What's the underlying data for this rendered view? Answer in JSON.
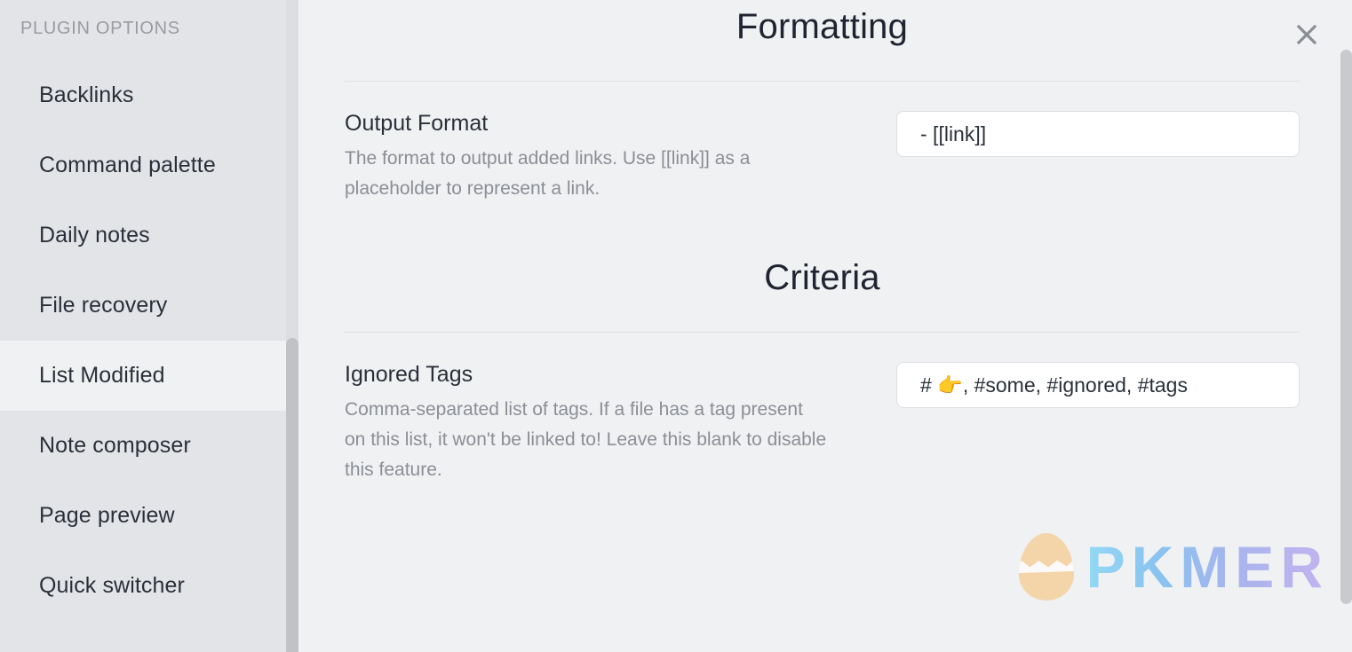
{
  "sidebar": {
    "title": "PLUGIN OPTIONS",
    "items": [
      {
        "label": "Backlinks",
        "active": false
      },
      {
        "label": "Command palette",
        "active": false
      },
      {
        "label": "Daily notes",
        "active": false
      },
      {
        "label": "File recovery",
        "active": false
      },
      {
        "label": "List Modified",
        "active": true
      },
      {
        "label": "Note composer",
        "active": false
      },
      {
        "label": "Page preview",
        "active": false
      },
      {
        "label": "Quick switcher",
        "active": false
      }
    ]
  },
  "main": {
    "close_label": "×",
    "sections": [
      {
        "heading": "Formatting",
        "settings": [
          {
            "name": "Output Format",
            "description": "The format to output added links. Use [[link]] as a placeholder to represent a link.",
            "value": "- [[link]]",
            "placeholder": ""
          }
        ]
      },
      {
        "heading": "Criteria",
        "settings": [
          {
            "name": "Ignored Tags",
            "description": "Comma-separated list of tags. If a file has a tag present on this list, it won't be linked to! Leave this blank to disable this feature.",
            "value": "# 👉, #some, #ignored, #tags",
            "placeholder": ""
          }
        ]
      }
    ]
  },
  "watermark": {
    "text": "PKMER"
  },
  "colors": {
    "sidebar_bg": "#e3e4e8",
    "main_bg": "#f0f1f3",
    "active_item_bg": "#f0f1f3",
    "text_primary": "#2a3039",
    "text_muted": "#8b8e95",
    "input_bg": "#ffffff",
    "input_border": "#dcdee2",
    "divider": "#dfe1e5",
    "scrollbar_thumb": "#c0c2c6"
  }
}
